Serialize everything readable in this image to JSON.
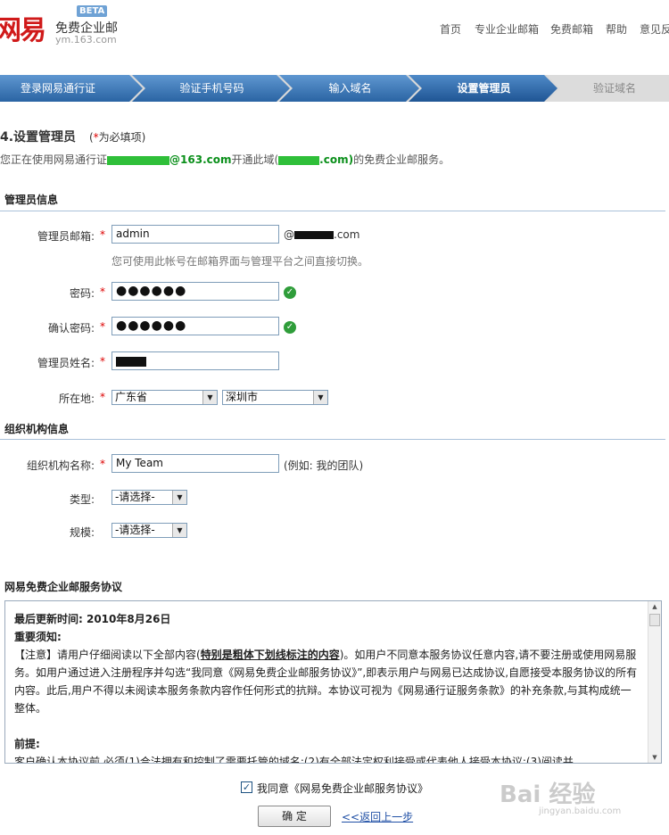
{
  "header": {
    "logo_mark": "网易",
    "logo_name": "免费企业邮",
    "logo_beta": "BETA",
    "logo_domain": "ym.163.com",
    "nav": [
      "首页",
      "专业企业邮箱",
      "免费邮箱",
      "帮助",
      "意见反"
    ]
  },
  "steps": [
    "登录网易通行证",
    "验证手机号码",
    "输入域名",
    "设置管理员",
    "验证域名"
  ],
  "form": {
    "title": "4.设置管理员",
    "required_note_prefix": "(",
    "required_note_star": "*",
    "required_note_suffix": "为必填项)",
    "desc_prefix": "您正在使用网易通行证",
    "desc_account_suffix": "@163.com",
    "desc_middle": "开通此域(",
    "desc_domain_suffix": ".com)",
    "desc_end": "的免费企业邮服务。",
    "section_admin": "管理员信息",
    "admin_email_label": "管理员邮箱:",
    "admin_email_value": "admin",
    "admin_email_domain_prefix": "@",
    "admin_email_domain_suffix": ".com",
    "admin_email_hint": "您可使用此帐号在邮箱界面与管理平台之间直接切换。",
    "password_label": "密码:",
    "password_value": "●●●●●●",
    "confirm_label": "确认密码:",
    "confirm_value": "●●●●●●",
    "name_label": "管理员姓名:",
    "location_label": "所在地:",
    "province": "广东省",
    "city": "深圳市",
    "section_org": "组织机构信息",
    "org_name_label": "组织机构名称:",
    "org_name_value": "My Team",
    "org_name_hint": "(例如: 我的团队)",
    "type_label": "类型:",
    "type_value": "-请选择-",
    "scale_label": "规模:",
    "scale_value": "-请选择-",
    "required_star": "*"
  },
  "agreement": {
    "title": "网易免费企业邮服务协议",
    "updated": "最后更新时间: 2010年8月26日",
    "notice_heading": "重要须知:",
    "notice_lead": "【注意】请用户仔细阅读以下全部内容(",
    "notice_bold": "特别是粗体下划线标注的内容",
    "notice_rest": ")。如用户不同意本服务协议任意内容,请不要注册或使用网易服务。如用户通过进入注册程序并勾选“我同意《网易免费企业邮服务协议》”,即表示用户与网易已达成协议,自愿接受本服务协议的所有内容。此后,用户不得以未阅读本服务条款内容作任何形式的抗辩。本协议可视为《网易通行证服务条款》的补充条款,与其构成统一整体。",
    "premise_heading": "前提:",
    "premise_text": "客户确认本协议前,必须(1)合法拥有和控制了需要托管的域名;(2)有全部法定权利接受或代表他人接受本协议;(3)阅读并"
  },
  "footer": {
    "agree_label": "我同意《网易免费企业邮服务协议》",
    "confirm_button": "确 定",
    "back_link": "<<返回上一步"
  },
  "watermark": {
    "main": "Bai 经验",
    "sub": "jingyan.baidu.com"
  },
  "colors": {
    "step_active": "#2f6ca9",
    "step_done": "#3b7bbd",
    "step_pending": "#d9d9d9",
    "accent_green": "#0a8f1a",
    "required_red": "#dd0000"
  }
}
